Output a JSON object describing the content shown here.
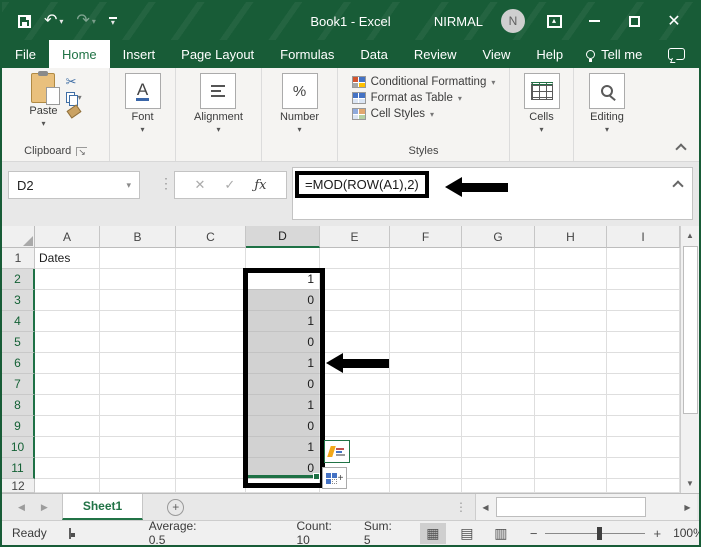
{
  "titlebar": {
    "title": "Book1 - Excel",
    "user": "NIRMAL",
    "avatar": "N"
  },
  "menu_tabs": [
    "File",
    "Home",
    "Insert",
    "Page Layout",
    "Formulas",
    "Data",
    "Review",
    "View",
    "Help",
    "Tell me"
  ],
  "ribbon": {
    "paste": "Paste",
    "clipboard_group": "Clipboard",
    "font_group": "Font",
    "alignment_group": "Alignment",
    "number_group": "Number",
    "styles_items": [
      "Conditional Formatting",
      "Format as Table",
      "Cell Styles"
    ],
    "styles_group": "Styles",
    "cells_group": "Cells",
    "editing_group": "Editing"
  },
  "formula_bar": {
    "name_box": "D2",
    "formula": "=MOD(ROW(A1),2)",
    "fx": "ƒx"
  },
  "grid": {
    "columns": [
      "A",
      "B",
      "C",
      "D",
      "E",
      "F",
      "G",
      "H",
      "I"
    ],
    "row_numbers": [
      "1",
      "2",
      "3",
      "4",
      "5",
      "6",
      "7",
      "8",
      "9",
      "10",
      "11",
      "12"
    ],
    "cells": {
      "A1": "Dates"
    },
    "d_values": [
      "1",
      "0",
      "1",
      "0",
      "1",
      "0",
      "1",
      "0",
      "1",
      "0"
    ]
  },
  "sheet_bar": {
    "active_tab": "Sheet1"
  },
  "status_bar": {
    "mode": "Ready",
    "average": "Average: 0.5",
    "count": "Count: 10",
    "sum": "Sum: 5",
    "zoom_level": "100%"
  },
  "icons": {
    "dropdown": "▾",
    "undo": "↶",
    "redo": "↷",
    "scissors": "✂",
    "cancel": "✕",
    "check": "✓",
    "dots_v": "⋮",
    "up_arrow": "▲",
    "down_arrow": "▼",
    "left_arrow": "◀",
    "right_arrow": "▶",
    "add": "+",
    "plus": "+",
    "minus": "−",
    "percent": "%",
    "font_a": "A",
    "grid_view": "▦",
    "page_layout_view": "▤",
    "page_break_view": "▥",
    "restore_arrow": "▴"
  },
  "colors": {
    "accent_green": "#217346",
    "titlebar_green": "#185c37",
    "selection_gray": "#d2d2d2"
  }
}
